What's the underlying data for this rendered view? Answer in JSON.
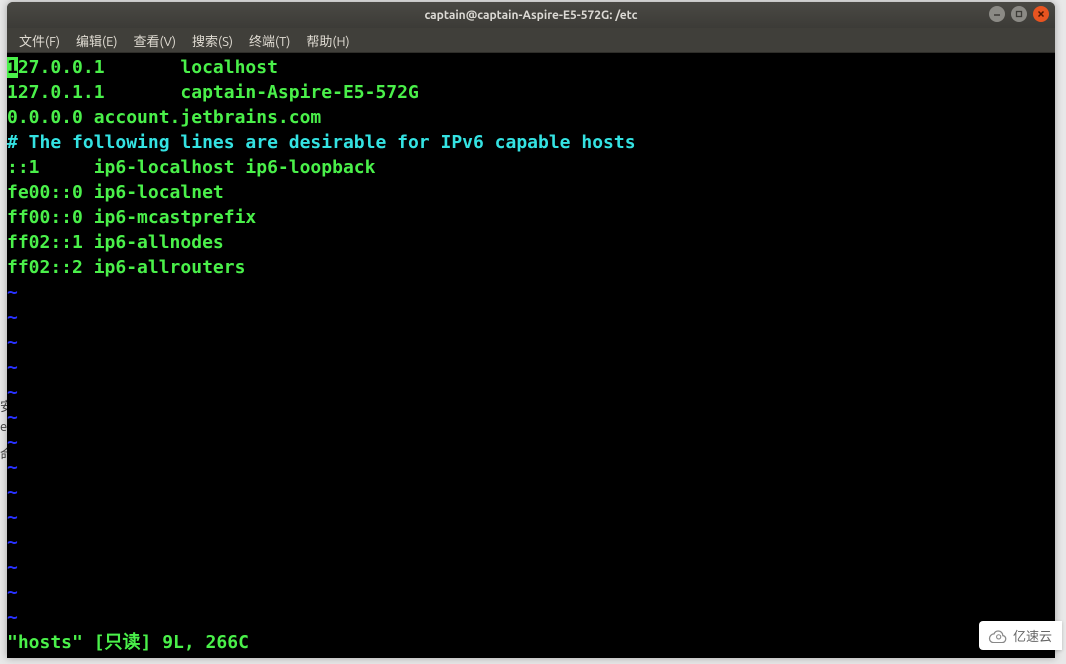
{
  "titlebar": {
    "title": "captain@captain-Aspire-E5-572G: /etc"
  },
  "menubar": {
    "items": [
      "文件(F)",
      "编辑(E)",
      "查看(V)",
      "搜索(S)",
      "终端(T)",
      "帮助(H)"
    ]
  },
  "terminal": {
    "cursor_char": "1",
    "lines": {
      "l0_rest": "27.0.0.1       localhost",
      "l1": "127.0.1.1       captain-Aspire-E5-572G",
      "l2": "0.0.0.0 account.jetbrains.com",
      "l3_comment": "# The following lines are desirable for IPv6 capable hosts",
      "l4": "::1     ip6-localhost ip6-loopback",
      "l5": "fe00::0 ip6-localnet",
      "l6": "ff00::0 ip6-mcastprefix",
      "l7": "ff02::1 ip6-allnodes",
      "l8": "ff02::2 ip6-allrouters"
    },
    "tilde": "~",
    "status": "\"hosts\" [只读] 9L, 266C"
  },
  "watermark": {
    "text": "亿速云"
  },
  "bg_chars": {
    "a": "安",
    "b": "e",
    "c": "命"
  }
}
